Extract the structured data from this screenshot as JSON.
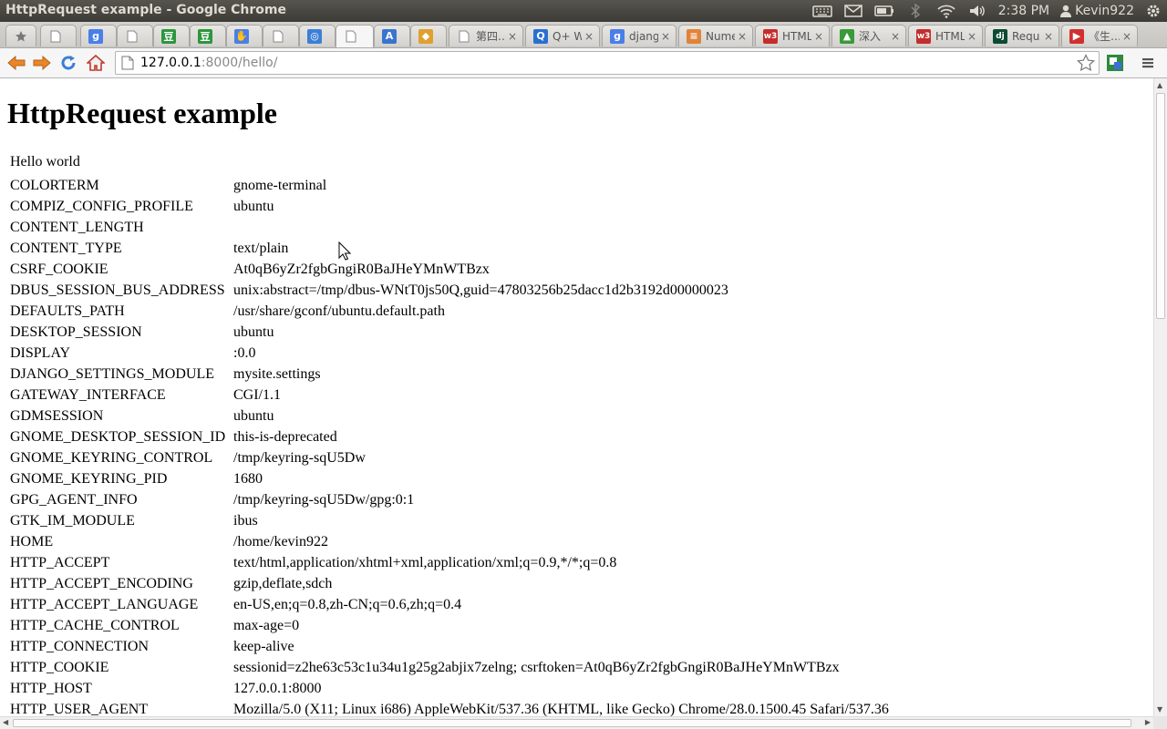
{
  "window": {
    "title": "HttpRequest example - Google Chrome"
  },
  "tray": {
    "clock": "2:38 PM",
    "user": "Kevin922"
  },
  "tabs": [
    {
      "label": "",
      "favicon": "star-icon",
      "color": "#777777"
    },
    {
      "label": "",
      "favicon": "page-icon",
      "color": "#ffffff"
    },
    {
      "label": "",
      "favicon": "google-icon",
      "color": "#4a7fe8"
    },
    {
      "label": "",
      "favicon": "page-icon",
      "color": "#ffffff"
    },
    {
      "label": "",
      "favicon": "douban-icon",
      "color": "#2d963d"
    },
    {
      "label": "",
      "favicon": "douban-icon",
      "color": "#2d963d"
    },
    {
      "label": "",
      "favicon": "hand-icon",
      "color": "#4a7fe8"
    },
    {
      "label": "",
      "favicon": "page-icon",
      "color": "#ffffff"
    },
    {
      "label": "",
      "favicon": "circle-icon",
      "color": "#3b7fd6"
    },
    {
      "label": "",
      "favicon": "page-icon",
      "color": "#ffffff",
      "active": true
    },
    {
      "label": "",
      "favicon": "translate-icon",
      "color": "#3a74d0"
    },
    {
      "label": "",
      "favicon": "chart-icon",
      "color": "#e0a030"
    },
    {
      "label": "第四…",
      "favicon": "page-icon",
      "color": "#ffffff"
    },
    {
      "label": "Q+ W",
      "favicon": "qplus-icon",
      "color": "#2a6fd0"
    },
    {
      "label": "djang",
      "favicon": "google-icon",
      "color": "#4a7fe8"
    },
    {
      "label": "Nume",
      "favicon": "stack-icon",
      "color": "#e0833a"
    },
    {
      "label": "HTML",
      "favicon": "w3-icon",
      "color": "#c52d2d"
    },
    {
      "label": "深入",
      "favicon": "android-icon",
      "color": "#3a9a3a"
    },
    {
      "label": "HTML",
      "favicon": "w3-icon",
      "color": "#c52d2d"
    },
    {
      "label": "Requ",
      "favicon": "django-icon",
      "color": "#0c4b33"
    },
    {
      "label": "《生…",
      "favicon": "play-icon",
      "color": "#d03030"
    }
  ],
  "toolbar": {
    "url_host": "127.0.0.1",
    "url_rest": ":8000/hello/"
  },
  "page": {
    "heading": "HttpRequest example",
    "hello": "Hello world",
    "env": [
      {
        "key": "COLORTERM",
        "value": "gnome-terminal"
      },
      {
        "key": "COMPIZ_CONFIG_PROFILE",
        "value": "ubuntu"
      },
      {
        "key": "CONTENT_LENGTH",
        "value": ""
      },
      {
        "key": "CONTENT_TYPE",
        "value": "text/plain"
      },
      {
        "key": "CSRF_COOKIE",
        "value": "At0qB6yZr2fgbGngiR0BaJHeYMnWTBzx"
      },
      {
        "key": "DBUS_SESSION_BUS_ADDRESS",
        "value": "unix:abstract=/tmp/dbus-WNtT0js50Q,guid=47803256b25dacc1d2b3192d00000023"
      },
      {
        "key": "DEFAULTS_PATH",
        "value": "/usr/share/gconf/ubuntu.default.path"
      },
      {
        "key": "DESKTOP_SESSION",
        "value": "ubuntu"
      },
      {
        "key": "DISPLAY",
        "value": ":0.0"
      },
      {
        "key": "DJANGO_SETTINGS_MODULE",
        "value": "mysite.settings"
      },
      {
        "key": "GATEWAY_INTERFACE",
        "value": "CGI/1.1"
      },
      {
        "key": "GDMSESSION",
        "value": "ubuntu"
      },
      {
        "key": "GNOME_DESKTOP_SESSION_ID",
        "value": "this-is-deprecated"
      },
      {
        "key": "GNOME_KEYRING_CONTROL",
        "value": "/tmp/keyring-sqU5Dw"
      },
      {
        "key": "GNOME_KEYRING_PID",
        "value": "1680"
      },
      {
        "key": "GPG_AGENT_INFO",
        "value": "/tmp/keyring-sqU5Dw/gpg:0:1"
      },
      {
        "key": "GTK_IM_MODULE",
        "value": "ibus"
      },
      {
        "key": "HOME",
        "value": "/home/kevin922"
      },
      {
        "key": "HTTP_ACCEPT",
        "value": "text/html,application/xhtml+xml,application/xml;q=0.9,*/*;q=0.8"
      },
      {
        "key": "HTTP_ACCEPT_ENCODING",
        "value": "gzip,deflate,sdch"
      },
      {
        "key": "HTTP_ACCEPT_LANGUAGE",
        "value": "en-US,en;q=0.8,zh-CN;q=0.6,zh;q=0.4"
      },
      {
        "key": "HTTP_CACHE_CONTROL",
        "value": "max-age=0"
      },
      {
        "key": "HTTP_CONNECTION",
        "value": "keep-alive"
      },
      {
        "key": "HTTP_COOKIE",
        "value": "sessionid=z2he63c53c1u34u1g25g2abjix7zelng; csrftoken=At0qB6yZr2fgbGngiR0BaJHeYMnWTBzx"
      },
      {
        "key": "HTTP_HOST",
        "value": "127.0.0.1:8000"
      },
      {
        "key": "HTTP_USER_AGENT",
        "value": "Mozilla/5.0 (X11; Linux i686) AppleWebKit/537.36 (KHTML, like Gecko) Chrome/28.0.1500.45 Safari/537.36"
      }
    ]
  }
}
